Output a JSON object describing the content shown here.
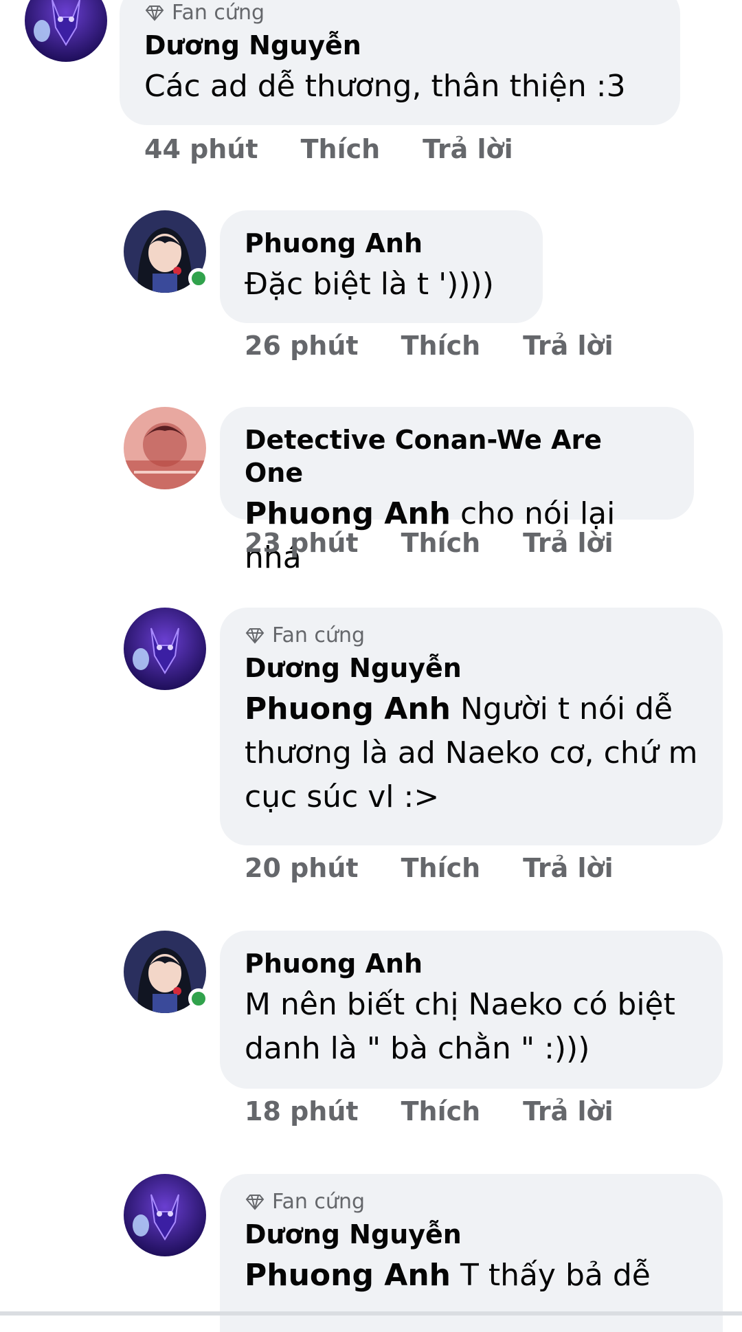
{
  "comments": [
    {
      "badge": "Fan cứng",
      "author": "Dương Nguyễn",
      "mention": "",
      "text": "Các ad dễ thương, thân thiện :3",
      "time": "44 phút",
      "like": "Thích",
      "reply": "Trả lời",
      "avatar": "purple-fox"
    },
    {
      "badge": "",
      "author": "Phuong Anh",
      "mention": "",
      "text": "Đặc biệt là t ')))) ",
      "time": "26 phút",
      "like": "Thích",
      "reply": "Trả lời",
      "avatar": "anime-girl",
      "online": true
    },
    {
      "badge": "",
      "author": "Detective Conan-We Are One",
      "mention": "Phuong Anh",
      "text": " cho nói lại nhá",
      "time": "23 phút",
      "like": "Thích",
      "reply": "Trả lời",
      "avatar": "conan-red"
    },
    {
      "badge": "Fan cứng",
      "author": "Dương Nguyễn",
      "mention": "Phuong Anh",
      "text": " Người t nói dễ thương là ad Naeko cơ, chứ m cục súc vl :>",
      "time": "20 phút",
      "like": "Thích",
      "reply": "Trả lời",
      "avatar": "purple-fox"
    },
    {
      "badge": "",
      "author": "Phuong Anh",
      "mention": "",
      "text": "M nên biết chị Naeko có biệt danh là \" bà chằn \" :)))",
      "time": "18 phút",
      "like": "Thích",
      "reply": "Trả lời",
      "avatar": "anime-girl",
      "online": true
    },
    {
      "badge": "Fan cứng",
      "author": "Dương Nguyễn",
      "mention": "Phuong Anh",
      "text": " T thấy bả dễ",
      "time": "",
      "like": "",
      "reply": "",
      "avatar": "purple-fox"
    }
  ],
  "colors": {
    "bubble": "#f0f2f5",
    "meta": "#65676b",
    "online": "#31a24c"
  },
  "icons": {
    "badge": "diamond-icon"
  }
}
